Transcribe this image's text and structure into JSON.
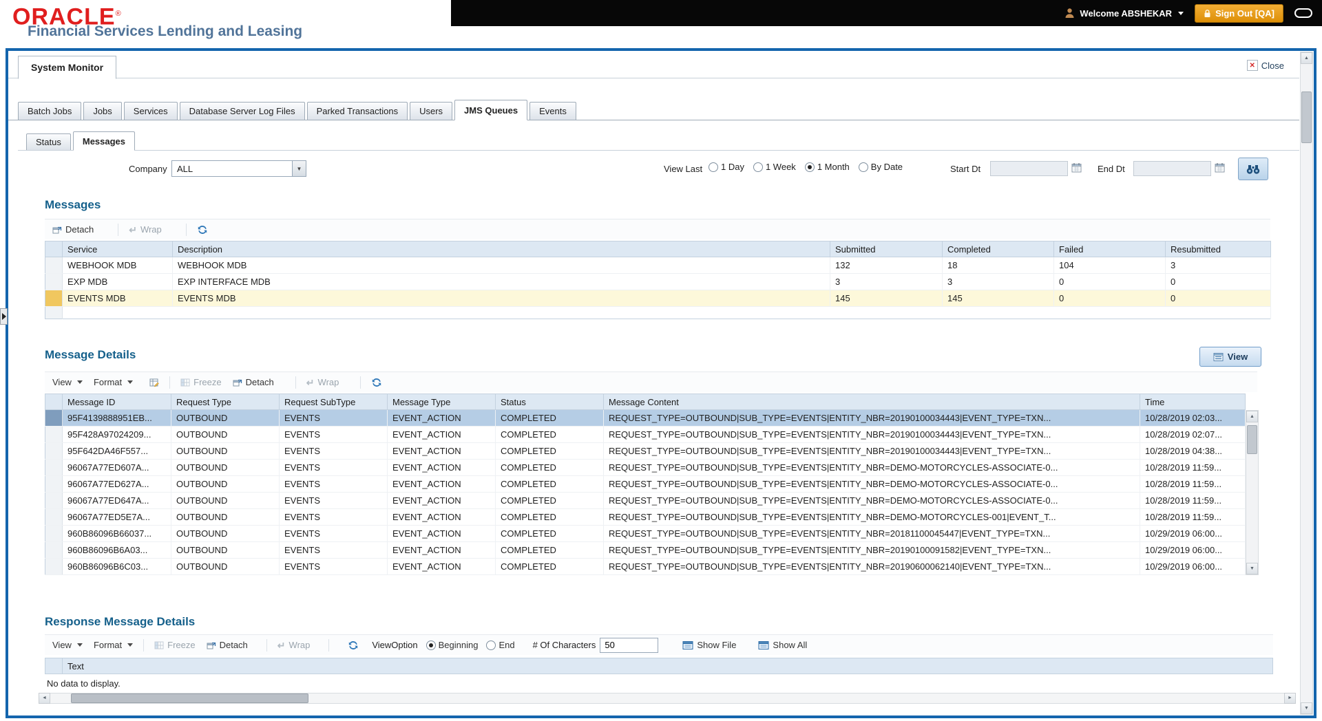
{
  "header": {
    "logo": "ORACLE",
    "logo_mark": "®",
    "subtitle": "Financial Services Lending and Leasing",
    "welcome": "Welcome ABSHEKAR",
    "sign_out": "Sign Out [QA]"
  },
  "window": {
    "title": "System Monitor",
    "close": "Close"
  },
  "main_tabs": [
    {
      "label": "Batch Jobs"
    },
    {
      "label": "Jobs"
    },
    {
      "label": "Services"
    },
    {
      "label": "Database Server Log Files"
    },
    {
      "label": "Parked Transactions"
    },
    {
      "label": "Users"
    },
    {
      "label": "JMS Queues",
      "active": true
    },
    {
      "label": "Events"
    }
  ],
  "sub_tabs": [
    {
      "label": "Status"
    },
    {
      "label": "Messages",
      "active": true
    }
  ],
  "filters": {
    "company_label": "Company",
    "company_value": "ALL",
    "view_last_label": "View Last",
    "view_last_options": [
      {
        "label": "1 Day"
      },
      {
        "label": "1 Week"
      },
      {
        "label": "1 Month",
        "selected": true
      },
      {
        "label": "By Date"
      }
    ],
    "start_dt_label": "Start Dt",
    "start_dt_value": "",
    "end_dt_label": "End Dt",
    "end_dt_value": ""
  },
  "messages": {
    "title": "Messages",
    "toolbar": {
      "detach": "Detach",
      "wrap": "Wrap"
    },
    "columns": [
      "Service",
      "Description",
      "Submitted",
      "Completed",
      "Failed",
      "Resubmitted"
    ],
    "rows": [
      {
        "service": "WEBHOOK MDB",
        "description": "WEBHOOK MDB",
        "submitted": "132",
        "completed": "18",
        "failed": "104",
        "resubmitted": "3"
      },
      {
        "service": "EXP MDB",
        "description": "EXP INTERFACE MDB",
        "submitted": "3",
        "completed": "3",
        "failed": "0",
        "resubmitted": "0"
      },
      {
        "service": "EVENTS MDB",
        "description": "EVENTS MDB",
        "submitted": "145",
        "completed": "145",
        "failed": "0",
        "resubmitted": "0",
        "row_class": "row-highlight"
      }
    ]
  },
  "message_details": {
    "title": "Message Details",
    "view_button": "View",
    "toolbar": {
      "view": "View",
      "format": "Format",
      "freeze": "Freeze",
      "detach": "Detach",
      "wrap": "Wrap"
    },
    "columns": [
      "Message ID",
      "Request Type",
      "Request SubType",
      "Message Type",
      "Status",
      "Message Content",
      "Time"
    ],
    "rows": [
      {
        "id": "95F4139888951EB...",
        "request_type": "OUTBOUND",
        "request_subtype": "EVENTS",
        "message_type": "EVENT_ACTION",
        "status": "COMPLETED",
        "content": "REQUEST_TYPE=OUTBOUND|SUB_TYPE=EVENTS|ENTITY_NBR=20190100034443|EVENT_TYPE=TXN...",
        "time": "10/28/2019 02:03...",
        "row_class": "row-selected"
      },
      {
        "id": "95F428A97024209...",
        "request_type": "OUTBOUND",
        "request_subtype": "EVENTS",
        "message_type": "EVENT_ACTION",
        "status": "COMPLETED",
        "content": "REQUEST_TYPE=OUTBOUND|SUB_TYPE=EVENTS|ENTITY_NBR=20190100034443|EVENT_TYPE=TXN...",
        "time": "10/28/2019 02:07..."
      },
      {
        "id": "95F642DA46F557...",
        "request_type": "OUTBOUND",
        "request_subtype": "EVENTS",
        "message_type": "EVENT_ACTION",
        "status": "COMPLETED",
        "content": "REQUEST_TYPE=OUTBOUND|SUB_TYPE=EVENTS|ENTITY_NBR=20190100034443|EVENT_TYPE=TXN...",
        "time": "10/28/2019 04:38..."
      },
      {
        "id": "96067A77ED607A...",
        "request_type": "OUTBOUND",
        "request_subtype": "EVENTS",
        "message_type": "EVENT_ACTION",
        "status": "COMPLETED",
        "content": "REQUEST_TYPE=OUTBOUND|SUB_TYPE=EVENTS|ENTITY_NBR=DEMO-MOTORCYCLES-ASSOCIATE-0...",
        "time": "10/28/2019 11:59..."
      },
      {
        "id": "96067A77ED627A...",
        "request_type": "OUTBOUND",
        "request_subtype": "EVENTS",
        "message_type": "EVENT_ACTION",
        "status": "COMPLETED",
        "content": "REQUEST_TYPE=OUTBOUND|SUB_TYPE=EVENTS|ENTITY_NBR=DEMO-MOTORCYCLES-ASSOCIATE-0...",
        "time": "10/28/2019 11:59..."
      },
      {
        "id": "96067A77ED647A...",
        "request_type": "OUTBOUND",
        "request_subtype": "EVENTS",
        "message_type": "EVENT_ACTION",
        "status": "COMPLETED",
        "content": "REQUEST_TYPE=OUTBOUND|SUB_TYPE=EVENTS|ENTITY_NBR=DEMO-MOTORCYCLES-ASSOCIATE-0...",
        "time": "10/28/2019 11:59..."
      },
      {
        "id": "96067A77ED5E7A...",
        "request_type": "OUTBOUND",
        "request_subtype": "EVENTS",
        "message_type": "EVENT_ACTION",
        "status": "COMPLETED",
        "content": "REQUEST_TYPE=OUTBOUND|SUB_TYPE=EVENTS|ENTITY_NBR=DEMO-MOTORCYCLES-001|EVENT_T...",
        "time": "10/28/2019 11:59..."
      },
      {
        "id": "960B86096B66037...",
        "request_type": "OUTBOUND",
        "request_subtype": "EVENTS",
        "message_type": "EVENT_ACTION",
        "status": "COMPLETED",
        "content": "REQUEST_TYPE=OUTBOUND|SUB_TYPE=EVENTS|ENTITY_NBR=20181100045447|EVENT_TYPE=TXN...",
        "time": "10/29/2019 06:00..."
      },
      {
        "id": "960B86096B6A03...",
        "request_type": "OUTBOUND",
        "request_subtype": "EVENTS",
        "message_type": "EVENT_ACTION",
        "status": "COMPLETED",
        "content": "REQUEST_TYPE=OUTBOUND|SUB_TYPE=EVENTS|ENTITY_NBR=20190100091582|EVENT_TYPE=TXN...",
        "time": "10/29/2019 06:00..."
      },
      {
        "id": "960B86096B6C03...",
        "request_type": "OUTBOUND",
        "request_subtype": "EVENTS",
        "message_type": "EVENT_ACTION",
        "status": "COMPLETED",
        "content": "REQUEST_TYPE=OUTBOUND|SUB_TYPE=EVENTS|ENTITY_NBR=20190600062140|EVENT_TYPE=TXN...",
        "time": "10/29/2019 06:00..."
      }
    ]
  },
  "response_details": {
    "title": "Response Message Details",
    "toolbar": {
      "view": "View",
      "format": "Format",
      "freeze": "Freeze",
      "detach": "Detach",
      "wrap": "Wrap"
    },
    "view_option_label": "ViewOption",
    "view_options": [
      {
        "label": "Beginning",
        "selected": true
      },
      {
        "label": "End"
      }
    ],
    "chars_label": "# Of Characters",
    "chars_value": "50",
    "show_file": "Show File",
    "show_all": "Show All",
    "columns": [
      "Text"
    ],
    "empty_text": "No data to display."
  },
  "icons": {
    "close": "✕",
    "wrap": "↵",
    "combo_caret": "▼",
    "scroll_up": "▲",
    "scroll_down": "▼",
    "scroll_left": "◄",
    "scroll_right": "►"
  },
  "colors": {
    "frame_border": "#1465ad",
    "section_title": "#15608b",
    "selected_row": "#b5cde5",
    "highlight_row": "#fdf8da",
    "highlight_gutter": "#f0c75f",
    "signout_button": "#e89b12",
    "oracle_red": "#e01e1e",
    "table_header": "#dde8f3"
  }
}
